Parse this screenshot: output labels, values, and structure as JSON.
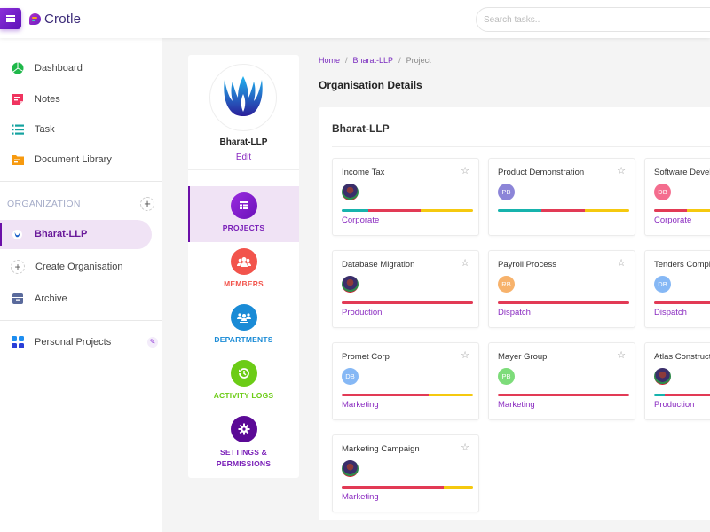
{
  "app": {
    "name": "Crotle"
  },
  "search": {
    "placeholder": "Search tasks.."
  },
  "sidebar": {
    "items": [
      {
        "label": "Dashboard",
        "icon": "pie-chart-icon"
      },
      {
        "label": "Notes",
        "icon": "note-icon"
      },
      {
        "label": "Task",
        "icon": "list-icon"
      },
      {
        "label": "Document Library",
        "icon": "folder-icon"
      }
    ],
    "org_section_title": "ORGANIZATION",
    "org_add": "+",
    "active_org": "Bharat-LLP",
    "create_org": "Create Organisation",
    "archive": "Archive",
    "personal_projects": "Personal Projects"
  },
  "org_panel": {
    "name": "Bharat-LLP",
    "edit_label": "Edit",
    "tabs": [
      {
        "label": "PROJECTS",
        "color": "#8a1fd0",
        "text_color": "#7a1fb8",
        "active": true
      },
      {
        "label": "MEMBERS",
        "color": "#f2544c",
        "text_color": "#f2544c"
      },
      {
        "label": "DEPARTMENTS",
        "color": "#1a8bd6",
        "text_color": "#1a8bd6"
      },
      {
        "label": "ACTIVITY LOGS",
        "color": "#6ccc16",
        "text_color": "#6ccc16"
      },
      {
        "label": "SETTINGS &",
        "label2": "PERMISSIONS",
        "color": "#5b0a96",
        "text_color": "#7a1fb8"
      }
    ]
  },
  "breadcrumb": {
    "home": "Home",
    "org": "Bharat-LLP",
    "current": "Project",
    "sep": "/"
  },
  "page_title": "Organisation Details",
  "org_title": "Bharat-LLP",
  "colors": {
    "teal": "#17b3ad",
    "red": "#e23a55",
    "yellow": "#f5c90f",
    "accent": "#8a2bc0"
  },
  "projects": [
    {
      "title": "Income Tax",
      "avatar": "photo",
      "initials": "",
      "progress": [
        [
          "teal",
          0.2
        ],
        [
          "red",
          0.4
        ],
        [
          "yellow",
          0.4
        ]
      ],
      "department": "Corporate"
    },
    {
      "title": "Product Demonstration",
      "avatar": "initials",
      "initials": "PB",
      "avatar_color": "#8c85d8",
      "progress": [
        [
          "teal",
          0.33
        ],
        [
          "red",
          0.33
        ],
        [
          "yellow",
          0.34
        ]
      ],
      "department": ""
    },
    {
      "title": "Software Development",
      "avatar": "initials",
      "initials": "DB",
      "avatar_color": "#f46d8e",
      "progress": [
        [
          "red",
          0.25
        ],
        [
          "yellow",
          0.75
        ]
      ],
      "department": "Corporate"
    },
    {
      "title": "Database Migration",
      "avatar": "photo",
      "initials": "",
      "progress": [
        [
          "red",
          1.0
        ]
      ],
      "department": "Production"
    },
    {
      "title": "Payroll Process",
      "avatar": "initials",
      "initials": "RB",
      "avatar_color": "#f7b26b",
      "progress": [
        [
          "red",
          1.0
        ]
      ],
      "department": "Dispatch"
    },
    {
      "title": "Tenders Completion",
      "avatar": "initials",
      "initials": "DB",
      "avatar_color": "#86b8f5",
      "progress": [
        [
          "red",
          1.0
        ]
      ],
      "department": "Dispatch"
    },
    {
      "title": "Promet Corp",
      "avatar": "initials",
      "initials": "DB",
      "avatar_color": "#86b8f5",
      "progress": [
        [
          "red",
          0.66
        ],
        [
          "yellow",
          0.34
        ]
      ],
      "department": "Marketing"
    },
    {
      "title": "Mayer Group",
      "avatar": "initials",
      "initials": "PB",
      "avatar_color": "#7ddc7a",
      "progress": [
        [
          "red",
          1.0
        ]
      ],
      "department": "Marketing"
    },
    {
      "title": "Atlas Construction",
      "avatar": "photo",
      "initials": "",
      "progress": [
        [
          "teal",
          0.08
        ],
        [
          "red",
          0.92
        ]
      ],
      "department": "Production"
    },
    {
      "title": "Marketing Campaign",
      "avatar": "photo",
      "initials": "",
      "progress": [
        [
          "red",
          0.78
        ],
        [
          "yellow",
          0.22
        ]
      ],
      "department": "Marketing"
    }
  ]
}
